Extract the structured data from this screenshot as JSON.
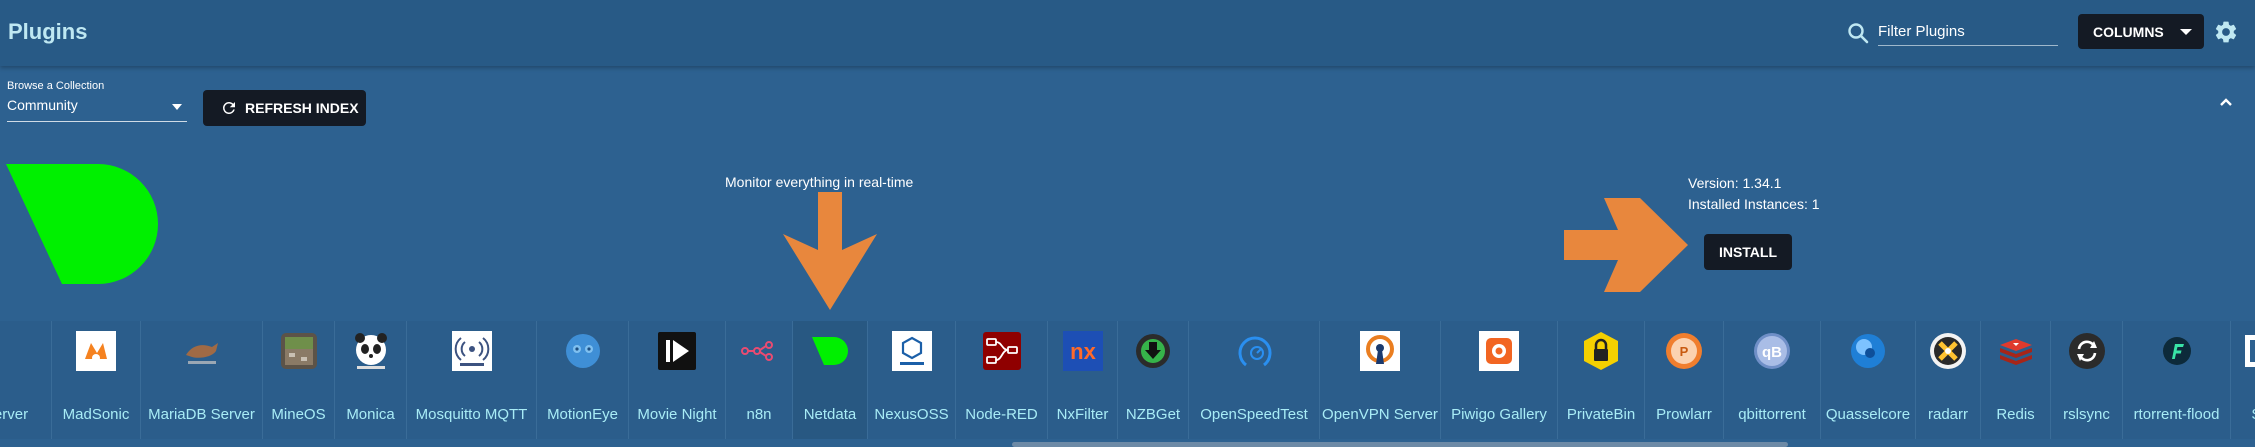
{
  "header": {
    "title": "Plugins",
    "search_placeholder": "Filter Plugins",
    "columns_label": "COLUMNS"
  },
  "toolbar": {
    "collection_label": "Browse a Collection",
    "collection_value": "Community",
    "refresh_label": "REFRESH INDEX"
  },
  "feature": {
    "tagline": "Monitor everything in real-time",
    "version": "Version: 1.34.1",
    "installed": "Installed Instances: 1",
    "install_label": "INSTALL",
    "logo_color": "#00f000",
    "arrow_color": "#e8873d"
  },
  "plugins": [
    {
      "name": "Server",
      "icon": "server-icon"
    },
    {
      "name": "MadSonic",
      "icon": "madsonic-icon"
    },
    {
      "name": "MariaDB Server",
      "icon": "mariadb-seal-icon"
    },
    {
      "name": "MineOS",
      "icon": "mineos-block-icon"
    },
    {
      "name": "Monica",
      "icon": "monica-panda-icon"
    },
    {
      "name": "Mosquitto MQTT",
      "icon": "mosquitto-icon"
    },
    {
      "name": "MotionEye",
      "icon": "motioneye-icon"
    },
    {
      "name": "Movie Night",
      "icon": "movie-night-play-icon"
    },
    {
      "name": "n8n",
      "icon": "n8n-nodes-icon"
    },
    {
      "name": "Netdata",
      "icon": "netdata-icon"
    },
    {
      "name": "NexusOSS",
      "icon": "nexus-hexagon-icon"
    },
    {
      "name": "Node-RED",
      "icon": "node-red-icon"
    },
    {
      "name": "NxFilter",
      "icon": "nxfilter-icon"
    },
    {
      "name": "NZBGet",
      "icon": "nzbget-download-icon"
    },
    {
      "name": "OpenSpeedTest",
      "icon": "speedometer-icon"
    },
    {
      "name": "OpenVPN Server",
      "icon": "openvpn-keyhole-icon"
    },
    {
      "name": "Piwigo Gallery",
      "icon": "piwigo-icon"
    },
    {
      "name": "PrivateBin",
      "icon": "privatebin-lock-icon"
    },
    {
      "name": "Prowlarr",
      "icon": "prowlarr-icon"
    },
    {
      "name": "qbittorrent",
      "icon": "qbittorrent-icon"
    },
    {
      "name": "Quasselcore",
      "icon": "quassel-icon"
    },
    {
      "name": "radarr",
      "icon": "radarr-icon"
    },
    {
      "name": "Redis",
      "icon": "redis-icon"
    },
    {
      "name": "rslsync",
      "icon": "resilio-sync-icon"
    },
    {
      "name": "rtorrent-flood",
      "icon": "flood-icon"
    },
    {
      "name": "Sa",
      "icon": "truncated-plugin-icon"
    }
  ]
}
